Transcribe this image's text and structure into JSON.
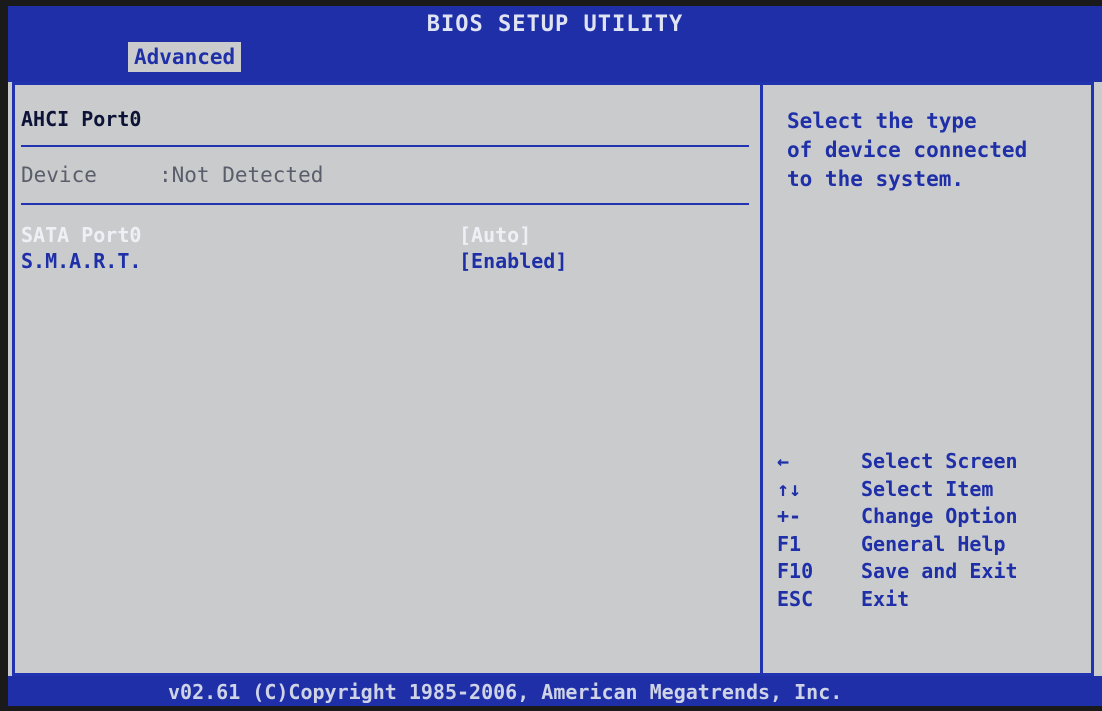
{
  "title": "BIOS SETUP UTILITY",
  "active_tab": "Advanced",
  "main": {
    "section_title": "AHCI Port0",
    "device": {
      "label": "Device",
      "value": ":Not Detected"
    },
    "options": [
      {
        "label": "SATA Port0",
        "value": "[Auto]"
      },
      {
        "label": "S.M.A.R.T.",
        "value": "[Enabled]"
      }
    ]
  },
  "help": {
    "lines": [
      "Select the type",
      "of device connected",
      "to the system."
    ]
  },
  "keys": [
    {
      "key": "←",
      "desc": "Select Screen"
    },
    {
      "key": "↑↓",
      "desc": "Select Item"
    },
    {
      "key": "+-",
      "desc": "Change Option"
    },
    {
      "key": "F1",
      "desc": "General Help"
    },
    {
      "key": "F10",
      "desc": "Save and Exit"
    },
    {
      "key": "ESC",
      "desc": "Exit"
    }
  ],
  "footer": "v02.61 (C)Copyright 1985-2006, American Megatrends, Inc.",
  "colors": {
    "bios_blue": "#1f2fa8",
    "background_gray": "#c9cbcd",
    "highlight_white": "#eef0f6"
  }
}
